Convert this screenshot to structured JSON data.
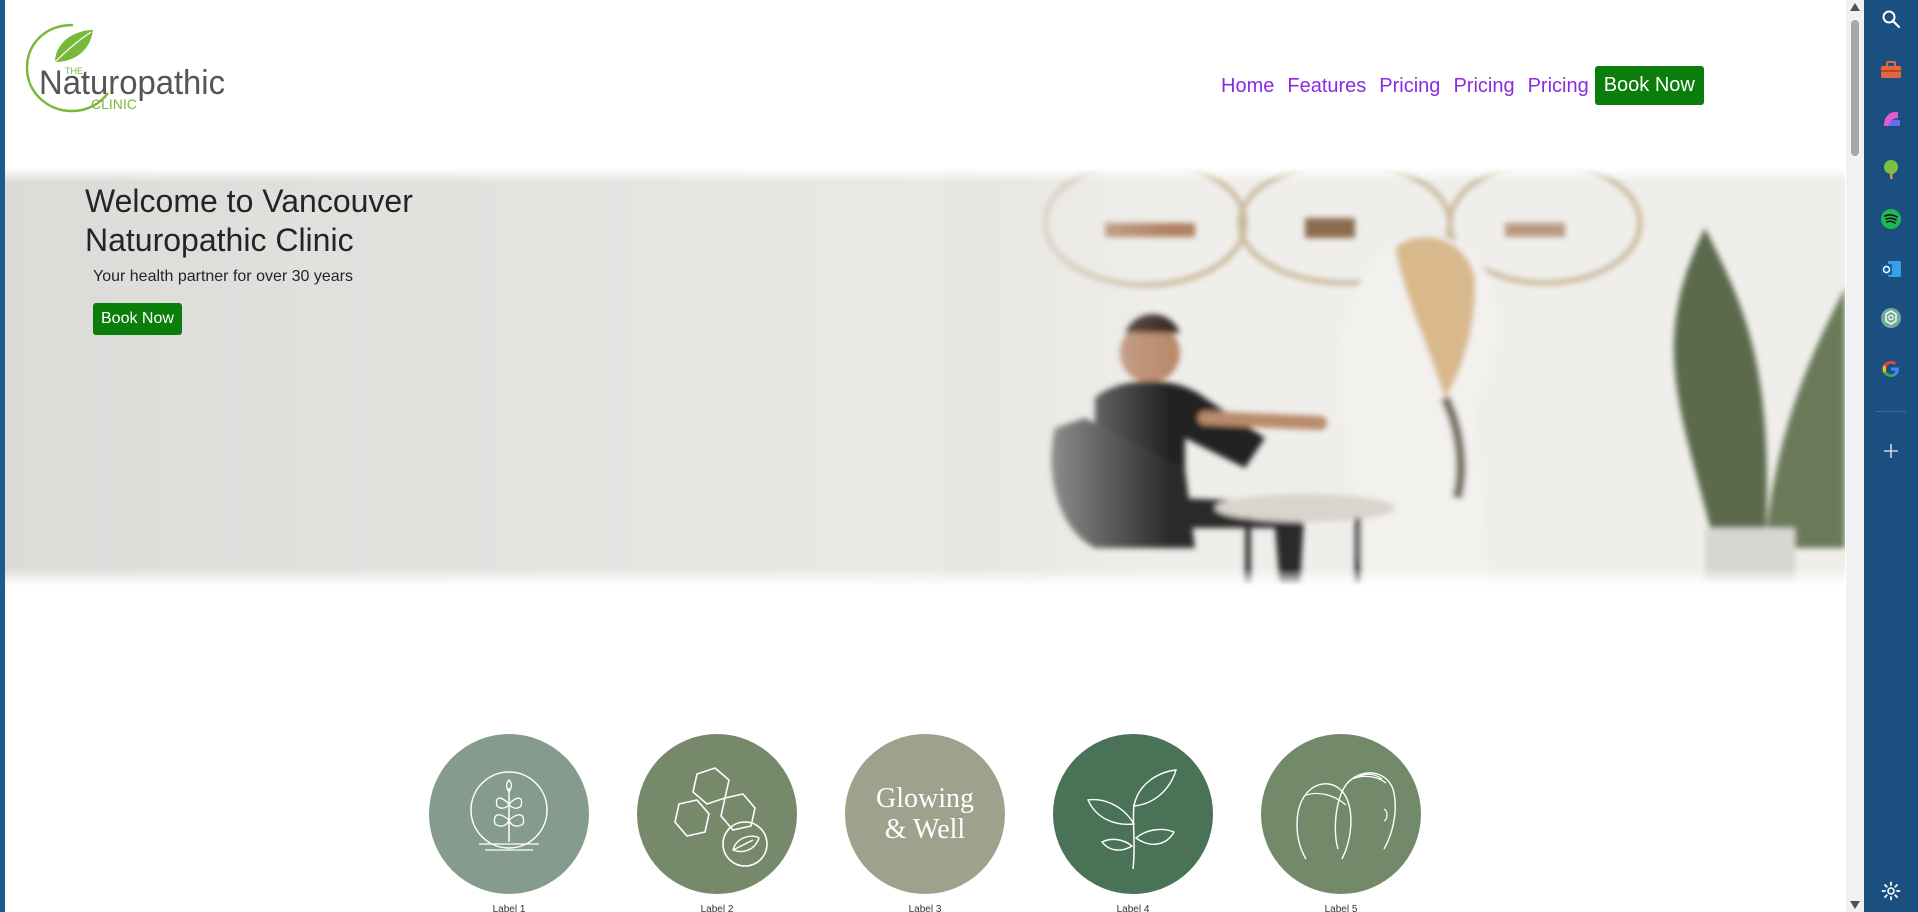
{
  "logo": {
    "the": "THE",
    "name": "Naturopathic",
    "clinic": "CLINIC"
  },
  "nav": {
    "items": [
      {
        "label": "Home"
      },
      {
        "label": "Features"
      },
      {
        "label": "Pricing"
      },
      {
        "label": "Pricing"
      },
      {
        "label": "Pricing"
      }
    ],
    "book_label": "Book Now"
  },
  "hero": {
    "title": "Welcome to Vancouver Naturopathic Clinic",
    "subtitle": "Your health partner for over 30 years",
    "button_label": "Book Now"
  },
  "circles": [
    {
      "label": "Label 1",
      "color": "#859b8d",
      "icon": "plant-in-circle-icon"
    },
    {
      "label": "Label 2",
      "color": "#76896a",
      "icon": "molecule-leaf-icon"
    },
    {
      "label": "Label 3",
      "color": "#9fa18c",
      "text_line1": "Glowing",
      "text_line2": "& Well"
    },
    {
      "label": "Label 4",
      "color": "#4a7256",
      "icon": "sprout-icon"
    },
    {
      "label": "Label 5",
      "color": "#728a6a",
      "icon": "two-faces-icon"
    }
  ],
  "sidebar": {
    "icons": [
      "search-icon",
      "toolbox-icon",
      "copilot-icon",
      "tree-icon",
      "spotify-icon",
      "outlook-icon",
      "chatgpt-icon",
      "google-icon",
      "add-icon",
      "settings-icon"
    ]
  },
  "colors": {
    "accent_link": "#8a2be2",
    "button_green": "#0a7d0a",
    "sidebar_blue": "#1b4f80"
  }
}
